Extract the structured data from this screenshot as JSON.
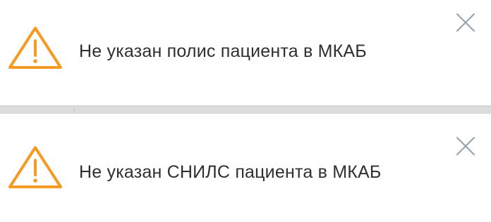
{
  "notifications": [
    {
      "icon": "warning-triangle-icon",
      "message": "Не указан полис пациента в МКАБ",
      "close_icon": "close-icon"
    },
    {
      "icon": "warning-triangle-icon",
      "message": "Не указан СНИЛС пациента в МКАБ",
      "close_icon": "close-icon"
    }
  ],
  "colors": {
    "warning": "#F59A23",
    "text": "#2F2F2F",
    "close": "#9AA3AE",
    "separator": "#DCDCDC"
  }
}
